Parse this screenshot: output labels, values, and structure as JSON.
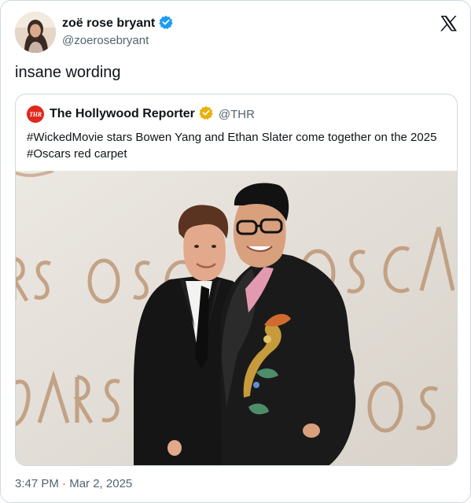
{
  "tweet": {
    "author": {
      "display_name": "zoë rose bryant",
      "handle": "@zoerosebryant",
      "verified_color": "#1d9bf0"
    },
    "text": "insane wording",
    "time": "3:47 PM",
    "separator": "·",
    "date": "Mar 2, 2025"
  },
  "quoted": {
    "logo_text": "THR",
    "display_name": "The Hollywood Reporter",
    "handle": "@THR",
    "verified_color": "#e8b008",
    "text": "#WickedMovie stars Bowen Yang and Ethan Slater come together on the 2025 #Oscars red carpet"
  },
  "icons": {
    "brand": "x-logo-icon",
    "verified": "verified-badge-icon"
  }
}
